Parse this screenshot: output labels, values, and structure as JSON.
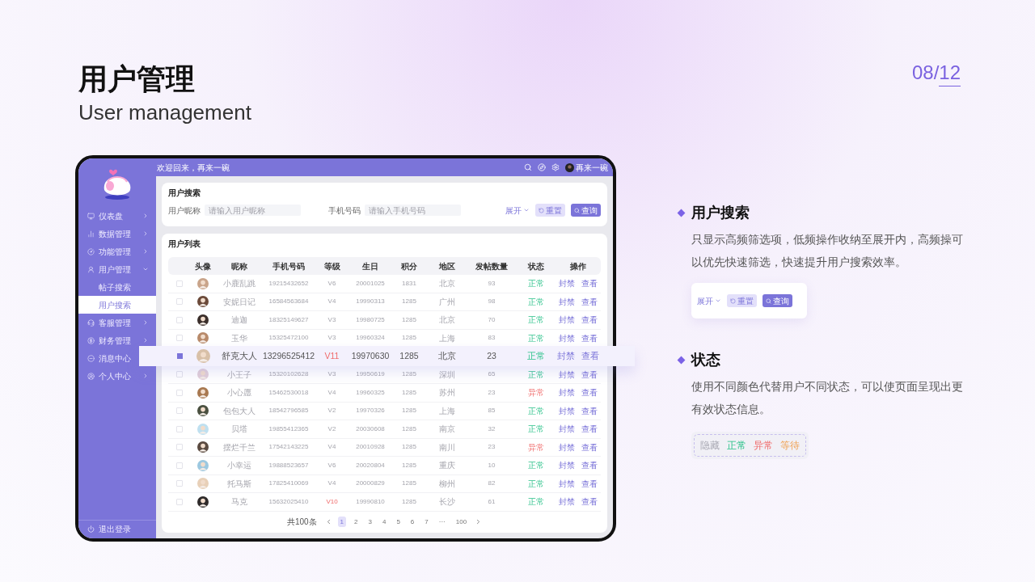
{
  "slide": {
    "title": "用户管理",
    "subtitle": "User management",
    "page_current": "08",
    "page_separator": "/",
    "page_total": "12"
  },
  "app": {
    "welcome": "欢迎回来，再来一碗",
    "user_name": "再来一碗",
    "sidebar": {
      "items": [
        {
          "label": "仪表盘",
          "expandable": true,
          "expanded": false
        },
        {
          "label": "数据管理",
          "expandable": true,
          "expanded": false
        },
        {
          "label": "功能管理",
          "expandable": true,
          "expanded": false
        },
        {
          "label": "用户管理",
          "expandable": true,
          "expanded": true,
          "children": [
            {
              "label": "帖子搜索",
              "selected": false
            },
            {
              "label": "用户搜索",
              "selected": true
            }
          ]
        },
        {
          "label": "客服管理",
          "expandable": true,
          "expanded": false
        },
        {
          "label": "财务管理",
          "expandable": true,
          "expanded": false
        },
        {
          "label": "消息中心",
          "expandable": false,
          "expanded": false
        },
        {
          "label": "个人中心",
          "expandable": true,
          "expanded": false
        }
      ],
      "logout": "退出登录"
    },
    "search_panel": {
      "title": "用户搜索",
      "fields": [
        {
          "label": "用户昵称",
          "placeholder": "请输入用户昵称"
        },
        {
          "label": "手机号码",
          "placeholder": "请输入手机号码"
        }
      ],
      "expand_label": "展开",
      "reset_label": "重置",
      "query_label": "查询"
    },
    "user_list": {
      "title": "用户列表",
      "columns": [
        "头像",
        "昵称",
        "手机号码",
        "等级",
        "生日",
        "积分",
        "地区",
        "发帖数量",
        "状态",
        "操作"
      ],
      "rows": [
        {
          "checked": false,
          "lifted": false,
          "nickname": "小鹿乱跳",
          "phone": "19215432652",
          "level": "V6",
          "level_alert": false,
          "birthday": "20001025",
          "points": "1831",
          "region": "北京",
          "posts": "93",
          "status": {
            "label": "正常",
            "kind": "normal"
          },
          "actions": [
            "封禁",
            "查看"
          ]
        },
        {
          "checked": false,
          "lifted": false,
          "nickname": "安妮日记",
          "phone": "16584563684",
          "level": "V4",
          "level_alert": false,
          "birthday": "19990313",
          "points": "1285",
          "region": "广州",
          "posts": "98",
          "status": {
            "label": "正常",
            "kind": "normal"
          },
          "actions": [
            "封禁",
            "查看"
          ]
        },
        {
          "checked": false,
          "lifted": false,
          "nickname": "迪迦",
          "phone": "18325149627",
          "level": "V3",
          "level_alert": false,
          "birthday": "19980725",
          "points": "1285",
          "region": "北京",
          "posts": "70",
          "status": {
            "label": "正常",
            "kind": "normal"
          },
          "actions": [
            "封禁",
            "查看"
          ]
        },
        {
          "checked": false,
          "lifted": false,
          "nickname": "玉华",
          "phone": "15325472100",
          "level": "V3",
          "level_alert": false,
          "birthday": "19960324",
          "points": "1285",
          "region": "上海",
          "posts": "83",
          "status": {
            "label": "正常",
            "kind": "normal"
          },
          "actions": [
            "封禁",
            "查看"
          ]
        },
        {
          "checked": true,
          "lifted": true,
          "nickname": "舒克大人",
          "phone": "13296525412",
          "level": "V11",
          "level_alert": true,
          "birthday": "19970630",
          "points": "1285",
          "region": "北京",
          "posts": "23",
          "status": {
            "label": "正常",
            "kind": "normal"
          },
          "actions": [
            "封禁",
            "查看"
          ]
        },
        {
          "checked": false,
          "lifted": false,
          "nickname": "小王子",
          "phone": "15320102628",
          "level": "V3",
          "level_alert": false,
          "birthday": "19950619",
          "points": "1285",
          "region": "深圳",
          "posts": "65",
          "status": {
            "label": "正常",
            "kind": "normal"
          },
          "actions": [
            "封禁",
            "查看"
          ]
        },
        {
          "checked": false,
          "lifted": false,
          "nickname": "小心愿",
          "phone": "15462530018",
          "level": "V4",
          "level_alert": false,
          "birthday": "19960325",
          "points": "1285",
          "region": "苏州",
          "posts": "23",
          "status": {
            "label": "异常",
            "kind": "abnormal"
          },
          "actions": [
            "封禁",
            "查看"
          ]
        },
        {
          "checked": false,
          "lifted": false,
          "nickname": "包包大人",
          "phone": "18542796585",
          "level": "V2",
          "level_alert": false,
          "birthday": "19970326",
          "points": "1285",
          "region": "上海",
          "posts": "85",
          "status": {
            "label": "正常",
            "kind": "normal"
          },
          "actions": [
            "封禁",
            "查看"
          ]
        },
        {
          "checked": false,
          "lifted": false,
          "nickname": "贝塔",
          "phone": "19855412365",
          "level": "V2",
          "level_alert": false,
          "birthday": "20030608",
          "points": "1285",
          "region": "南京",
          "posts": "32",
          "status": {
            "label": "正常",
            "kind": "normal"
          },
          "actions": [
            "封禁",
            "查看"
          ]
        },
        {
          "checked": false,
          "lifted": false,
          "nickname": "摆烂千兰",
          "phone": "17542143225",
          "level": "V4",
          "level_alert": false,
          "birthday": "20010928",
          "points": "1285",
          "region": "南川",
          "posts": "23",
          "status": {
            "label": "异常",
            "kind": "abnormal"
          },
          "actions": [
            "封禁",
            "查看"
          ]
        },
        {
          "checked": false,
          "lifted": false,
          "nickname": "小幸运",
          "phone": "19888523657",
          "level": "V6",
          "level_alert": false,
          "birthday": "20020804",
          "points": "1285",
          "region": "重庆",
          "posts": "10",
          "status": {
            "label": "正常",
            "kind": "normal"
          },
          "actions": [
            "封禁",
            "查看"
          ]
        },
        {
          "checked": false,
          "lifted": false,
          "nickname": "托马斯",
          "phone": "17825410069",
          "level": "V4",
          "level_alert": false,
          "birthday": "20000829",
          "points": "1285",
          "region": "柳州",
          "posts": "82",
          "status": {
            "label": "正常",
            "kind": "normal"
          },
          "actions": [
            "封禁",
            "查看"
          ]
        },
        {
          "checked": false,
          "lifted": false,
          "nickname": "马克",
          "phone": "15632025410",
          "level": "V10",
          "level_alert": true,
          "birthday": "19990810",
          "points": "1285",
          "region": "长沙",
          "posts": "61",
          "status": {
            "label": "正常",
            "kind": "normal"
          },
          "actions": [
            "封禁",
            "查看"
          ]
        }
      ],
      "pagination": {
        "total_label": "共100条",
        "pages": [
          {
            "label": "1",
            "selected": true
          },
          {
            "label": "2",
            "selected": false
          },
          {
            "label": "3",
            "selected": false
          },
          {
            "label": "4",
            "selected": false
          },
          {
            "label": "5",
            "selected": false
          },
          {
            "label": "6",
            "selected": false
          },
          {
            "label": "7",
            "selected": false
          },
          {
            "label": "···",
            "selected": false
          },
          {
            "label": "100",
            "selected": false
          }
        ]
      }
    }
  },
  "notes": [
    {
      "kind": "buttons",
      "title": "用户搜索",
      "body": "只显示高频筛选项，低频操作收纳至展开内，高频操可以优先快速筛选，快速提升用户搜索效率。",
      "expand_label": "展开",
      "reset_label": "重置",
      "query_label": "查询"
    },
    {
      "kind": "statuses",
      "title": "状态",
      "body": "使用不同颜色代替用户不同状态，可以使页面呈现出更有效状态信息。",
      "statuses": [
        {
          "label": "隐藏",
          "kind": "hidden"
        },
        {
          "label": "正常",
          "kind": "normal"
        },
        {
          "label": "异常",
          "kind": "abnormal"
        },
        {
          "label": "等待",
          "kind": "waiting"
        }
      ]
    }
  ]
}
